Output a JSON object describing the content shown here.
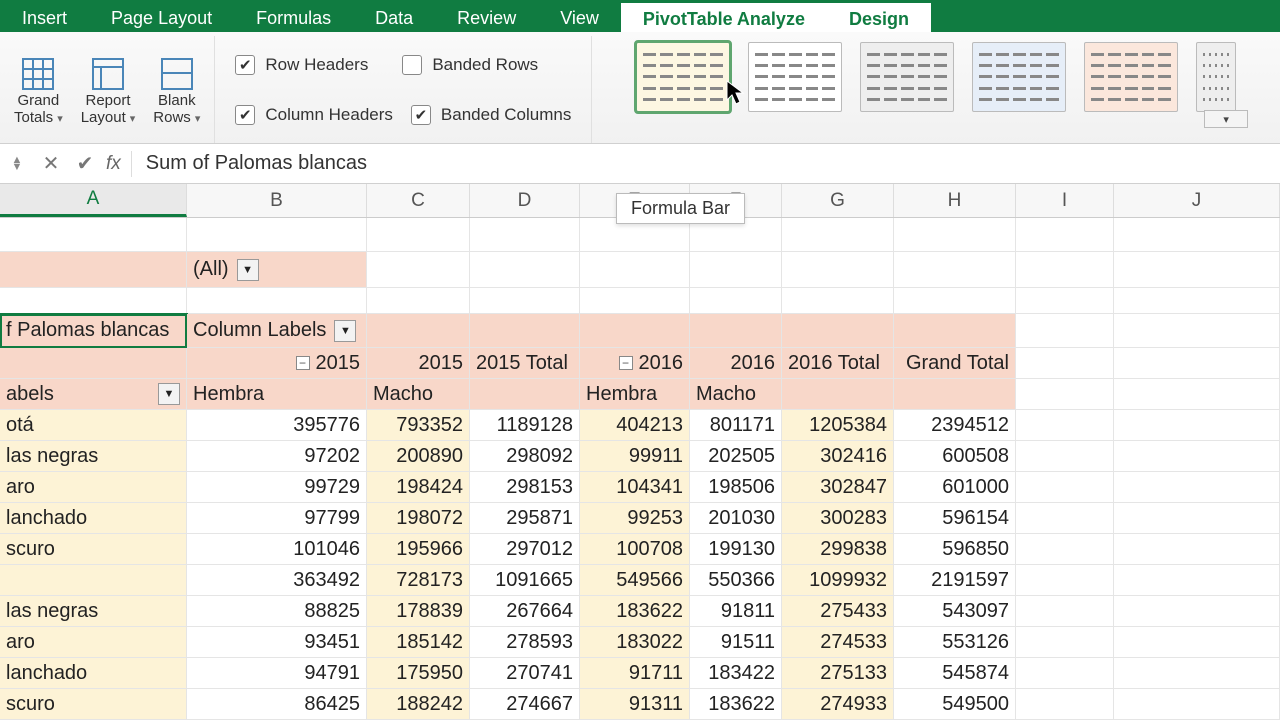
{
  "tabs": {
    "insert": "Insert",
    "page_layout": "Page Layout",
    "formulas": "Formulas",
    "data": "Data",
    "review": "Review",
    "view": "View",
    "pivot_analyze": "PivotTable Analyze",
    "design": "Design"
  },
  "ribbon": {
    "grand_totals": "Grand\nTotals",
    "report_layout": "Report\nLayout",
    "blank_rows": "Blank\nRows",
    "row_headers": "Row Headers",
    "column_headers": "Column Headers",
    "banded_rows": "Banded Rows",
    "banded_columns": "Banded Columns"
  },
  "formula_bar": {
    "fx": "fx",
    "content": "Sum of Palomas blancas",
    "tooltip": "Formula Bar"
  },
  "columns": [
    "A",
    "B",
    "C",
    "D",
    "E",
    "F",
    "G",
    "H",
    "I",
    "J"
  ],
  "pivot": {
    "filter_value": "(All)",
    "value_field": "f Palomas blancas",
    "col_labels": "Column Labels",
    "row_labels": "abels",
    "years": {
      "y1": "2015",
      "y1b": "2015",
      "y1t": "2015 Total",
      "y2": "2016",
      "y2b": "2016",
      "y2t": "2016 Total",
      "gt": "Grand Total"
    },
    "genders": {
      "hembra": "Hembra",
      "macho": "Macho",
      "hembra2": "Hembra",
      "macho2": "Macho"
    }
  },
  "rows": [
    {
      "label": "otá",
      "v": [
        "395776",
        "793352",
        "1189128",
        "404213",
        "801171",
        "1205384",
        "2394512"
      ]
    },
    {
      "label": "las negras",
      "v": [
        "97202",
        "200890",
        "298092",
        "99911",
        "202505",
        "302416",
        "600508"
      ]
    },
    {
      "label": "aro",
      "v": [
        "99729",
        "198424",
        "298153",
        "104341",
        "198506",
        "302847",
        "601000"
      ]
    },
    {
      "label": "lanchado",
      "v": [
        "97799",
        "198072",
        "295871",
        "99253",
        "201030",
        "300283",
        "596154"
      ]
    },
    {
      "label": "scuro",
      "v": [
        "101046",
        "195966",
        "297012",
        "100708",
        "199130",
        "299838",
        "596850"
      ]
    },
    {
      "label": "",
      "v": [
        "363492",
        "728173",
        "1091665",
        "549566",
        "550366",
        "1099932",
        "2191597"
      ]
    },
    {
      "label": "las negras",
      "v": [
        "88825",
        "178839",
        "267664",
        "183622",
        "91811",
        "275433",
        "543097"
      ]
    },
    {
      "label": "aro",
      "v": [
        "93451",
        "185142",
        "278593",
        "183022",
        "91511",
        "274533",
        "553126"
      ]
    },
    {
      "label": "lanchado",
      "v": [
        "94791",
        "175950",
        "270741",
        "91711",
        "183422",
        "275133",
        "545874"
      ]
    },
    {
      "label": "scuro",
      "v": [
        "86425",
        "188242",
        "274667",
        "91311",
        "183622",
        "274933",
        "549500"
      ]
    }
  ]
}
